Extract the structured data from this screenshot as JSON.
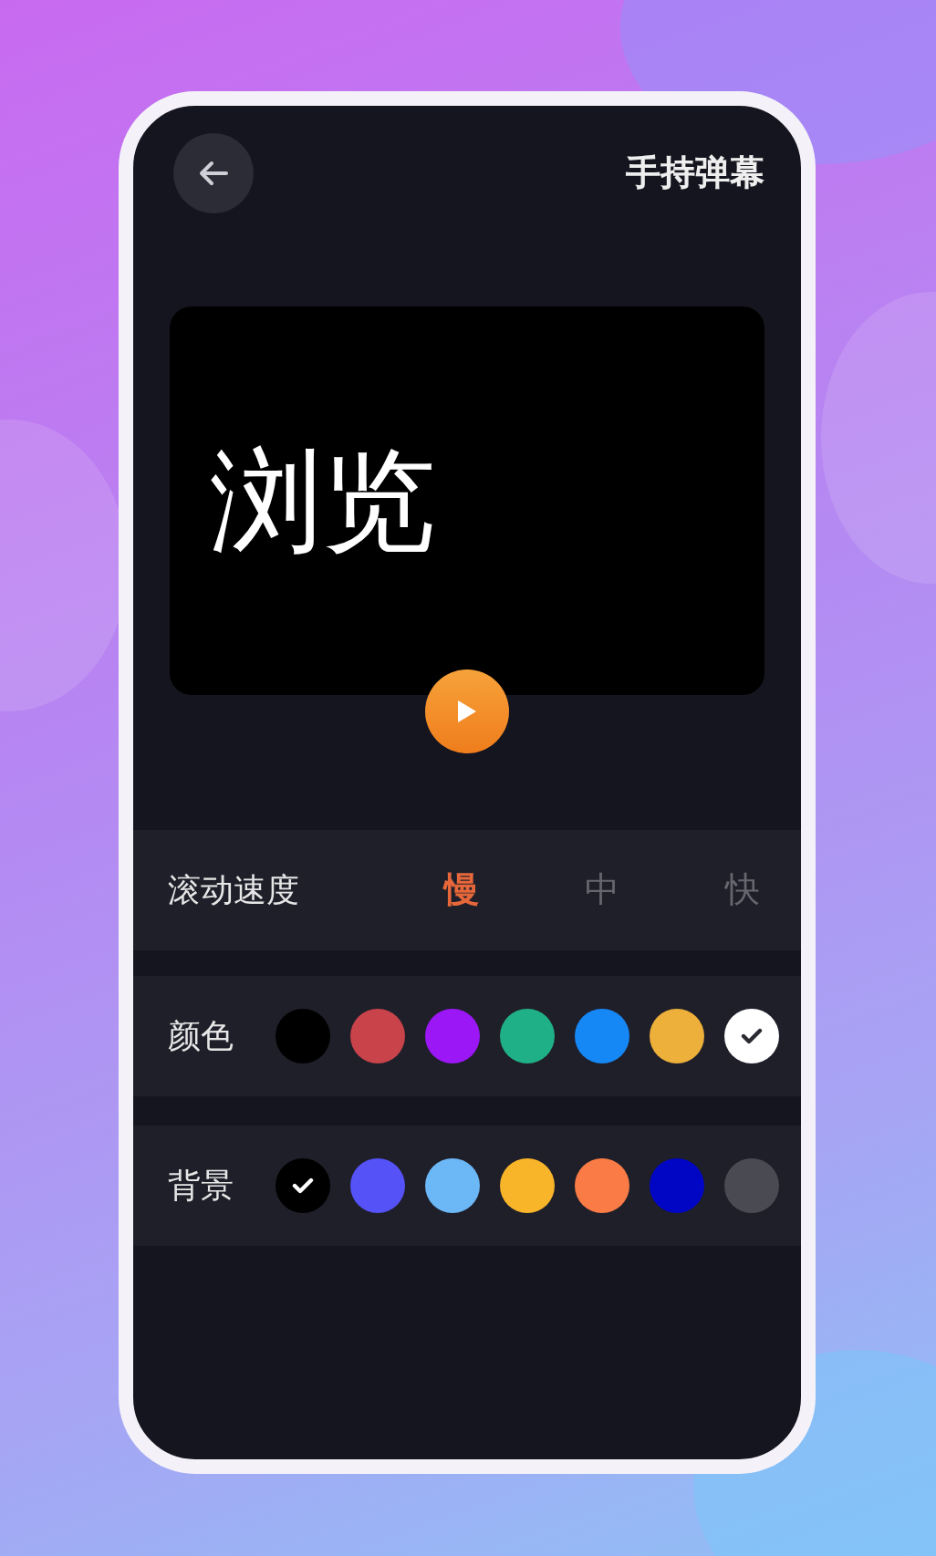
{
  "header": {
    "title": "手持弹幕"
  },
  "preview": {
    "text": "浏览"
  },
  "speed": {
    "label": "滚动速度",
    "options": [
      {
        "label": "慢",
        "selected": true
      },
      {
        "label": "中",
        "selected": false
      },
      {
        "label": "快",
        "selected": false
      }
    ]
  },
  "text_color": {
    "label": "颜色",
    "swatches": [
      {
        "color": "#000000",
        "selected": false
      },
      {
        "color": "#c8434a",
        "selected": false
      },
      {
        "color": "#9b17f5",
        "selected": false
      },
      {
        "color": "#20b088",
        "selected": false
      },
      {
        "color": "#1688f5",
        "selected": false
      },
      {
        "color": "#edb03a",
        "selected": false
      },
      {
        "color": "#ffffff",
        "selected": true
      }
    ]
  },
  "background": {
    "label": "背景",
    "swatches": [
      {
        "color": "#000000",
        "selected": true
      },
      {
        "color": "#5552f7",
        "selected": false
      },
      {
        "color": "#6cb7f6",
        "selected": false
      },
      {
        "color": "#f9b52a",
        "selected": false
      },
      {
        "color": "#fa7b45",
        "selected": false
      },
      {
        "color": "#0006c4",
        "selected": false
      },
      {
        "color": "#4a4a52",
        "selected": false
      }
    ]
  }
}
